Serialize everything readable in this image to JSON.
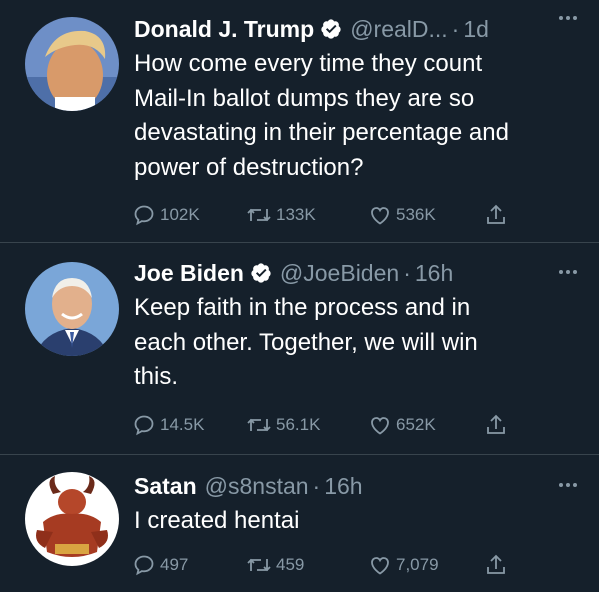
{
  "tweets": [
    {
      "name": "Donald J. Trump",
      "verified": true,
      "handle": "@realD...",
      "separator": "·",
      "time": "1d",
      "text_lines": [
        "How come every time they count",
        "Mail-In ballot dumps they are so",
        "devastating in their percentage and",
        "power of destruction?"
      ],
      "replies": "102K",
      "retweets": "133K",
      "likes": "536K"
    },
    {
      "name": "Joe Biden",
      "verified": true,
      "handle": "@JoeBiden",
      "separator": "·",
      "time": "16h",
      "text_lines": [
        "Keep faith in the process and in",
        "each other. Together, we will win",
        "this."
      ],
      "replies": "14.5K",
      "retweets": "56.1K",
      "likes": "652K"
    },
    {
      "name": "Satan",
      "verified": false,
      "handle": "@s8nstan",
      "separator": "·",
      "time": "16h",
      "text_lines": [
        "I created hentai"
      ],
      "replies": "497",
      "retweets": "459",
      "likes": "7,079"
    }
  ],
  "icons": {
    "reply": "reply-icon",
    "retweet": "retweet-icon",
    "like": "like-icon",
    "share": "share-icon",
    "verified": "verified-badge-icon",
    "more": "more-options-icon"
  },
  "colors": {
    "background": "#15202b",
    "text": "#ffffff",
    "muted": "#8899a6",
    "divider": "#38444d"
  }
}
